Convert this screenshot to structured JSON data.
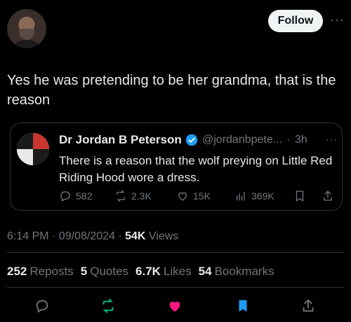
{
  "tweet": {
    "text": "Yes he was pretending to be her grandma, that is the reason",
    "follow_label": "Follow",
    "more_label": "···",
    "timestamp": "6:14 PM · 09/08/2024 · ",
    "views_count": "54K",
    "views_label": " Views"
  },
  "quote": {
    "name": "Dr Jordan B Peterson",
    "handle": "@jordanbpete...",
    "dot": "·",
    "time": "3h",
    "more": "···",
    "text": "There is a reason that the wolf preying on Little Red Riding Hood wore a dress.",
    "actions": {
      "replies": "582",
      "reposts": "2.3K",
      "likes": "15K",
      "views": "369K"
    }
  },
  "stats": {
    "reposts_count": "252",
    "reposts_label": "Reposts",
    "quotes_count": "5",
    "quotes_label": "Quotes",
    "likes_count": "6.7K",
    "likes_label": "Likes",
    "bookmarks_count": "54",
    "bookmarks_label": "Bookmarks"
  },
  "colors": {
    "background": "#000000",
    "text": "#e7e9ea",
    "muted": "#71767b",
    "repost_active": "#00ba7c",
    "like_active": "#f91880",
    "bookmark_active": "#1d9bf0",
    "verified": "#1d9bf0"
  },
  "icons": [
    "reply-icon",
    "repost-icon",
    "like-icon",
    "views-icon",
    "bookmark-icon",
    "share-icon",
    "verified-badge-icon"
  ]
}
